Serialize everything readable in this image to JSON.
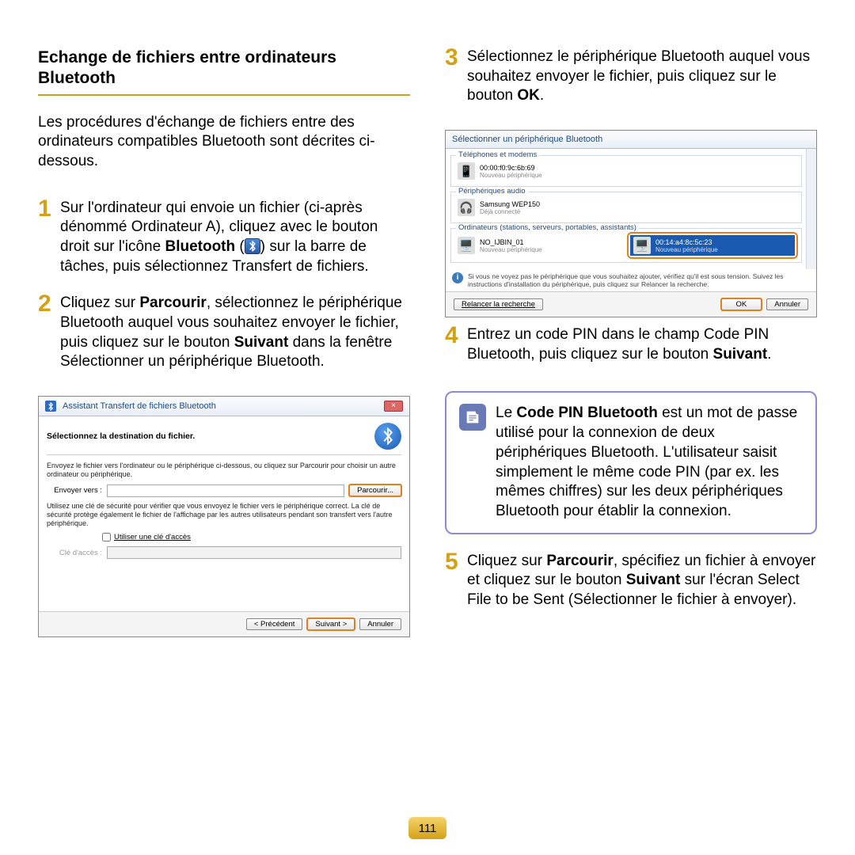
{
  "title": "Echange de fichiers entre ordinateurs Bluetooth",
  "intro": "Les procédures d'échange de fichiers entre des ordinateurs compatibles Bluetooth sont décrites ci-dessous.",
  "steps": {
    "s1": {
      "num": "1",
      "a": "Sur l'ordinateur qui envoie un fichier (ci-après dénommé Ordinateur A), cliquez avec le bouton droit sur l'icône ",
      "b1": "Bluetooth",
      "paren_open": " (",
      "paren_close": ") ",
      "c": "sur la barre de tâches, puis sélectionnez Transfert de fichiers."
    },
    "s2": {
      "num": "2",
      "a": "Cliquez sur ",
      "b1": "Parcourir",
      "b": ", sélectionnez le périphérique Bluetooth auquel vous souhaitez envoyer le fichier, puis cliquez sur le bouton ",
      "b2": "Suivant",
      "c": " dans la fenêtre Sélectionner un périphérique Bluetooth."
    },
    "s3": {
      "num": "3",
      "a": "Sélectionnez le périphérique Bluetooth auquel vous souhaitez envoyer le fichier, puis cliquez sur le bouton ",
      "b1": "OK",
      "c": "."
    },
    "s4": {
      "num": "4",
      "a": "Entrez un code PIN dans le champ Code PIN Bluetooth, puis cliquez sur le bouton ",
      "b1": "Suivant",
      "c": "."
    },
    "s5": {
      "num": "5",
      "a": "Cliquez sur ",
      "b1": "Parcourir",
      "b": ", spécifiez un fichier à envoyer et cliquez sur le bouton ",
      "b2": "Suivant",
      "c": " sur l'écran Select File to be Sent (Sélectionner le fichier à envoyer)."
    }
  },
  "note": {
    "a": "Le ",
    "b1": "Code PIN Bluetooth",
    "b": " est un mot de passe utilisé pour la connexion de deux périphériques Bluetooth. L'utilisateur saisit simplement le même code PIN (par ex. les mêmes chiffres) sur les deux périphériques Bluetooth pour établir la connexion."
  },
  "dialog1": {
    "title": "Assistant Transfert de fichiers Bluetooth",
    "close": "×",
    "heading": "Sélectionnez la destination du fichier.",
    "text1": "Envoyez le fichier vers l'ordinateur ou le périphérique ci-dessous, ou cliquez sur Parcourir pour choisir un autre ordinateur ou périphérique.",
    "sendto_label": "Envoyer vers :",
    "browse": "Parcourir...",
    "text2": "Utilisez une clé de sécurité pour vérifier que vous envoyez le fichier vers le périphérique correct. La clé de sécurité protège également le fichier de l'affichage par les autres utilisateurs pendant son transfert vers l'autre périphérique.",
    "chk": "Utiliser une clé d'accès",
    "key_label": "Clé d'accès :",
    "prev": "< Précédent",
    "next": "Suivant >",
    "cancel": "Annuler"
  },
  "dialog2": {
    "title": "Sélectionner un périphérique Bluetooth",
    "grp_phones": "Téléphones et modems",
    "dev_phone": "00:00:f0:9c:6b:69",
    "dev_phone_sub": "Nouveau périphérique",
    "grp_audio": "Périphériques audio",
    "dev_audio": "Samsung WEP150",
    "dev_audio_sub": "Déjà connecté",
    "grp_comp": "Ordinateurs (stations, serveurs, portables, assistants)",
    "dev_c1": "NO_IJBIN_01",
    "dev_c1_sub": "Nouveau périphérique",
    "dev_c2": "00:14:a4:8c:5c:23",
    "dev_c2_sub": "Nouveau périphérique",
    "info": "Si vous ne voyez pas le périphérique que vous souhaitez ajouter, vérifiez qu'il est sous tension. Suivez les instructions d'installation du périphérique, puis cliquez sur Relancer la recherche.",
    "refresh": "Relancer la recherche",
    "ok": "OK",
    "cancel": "Annuler"
  },
  "page_number": "111"
}
